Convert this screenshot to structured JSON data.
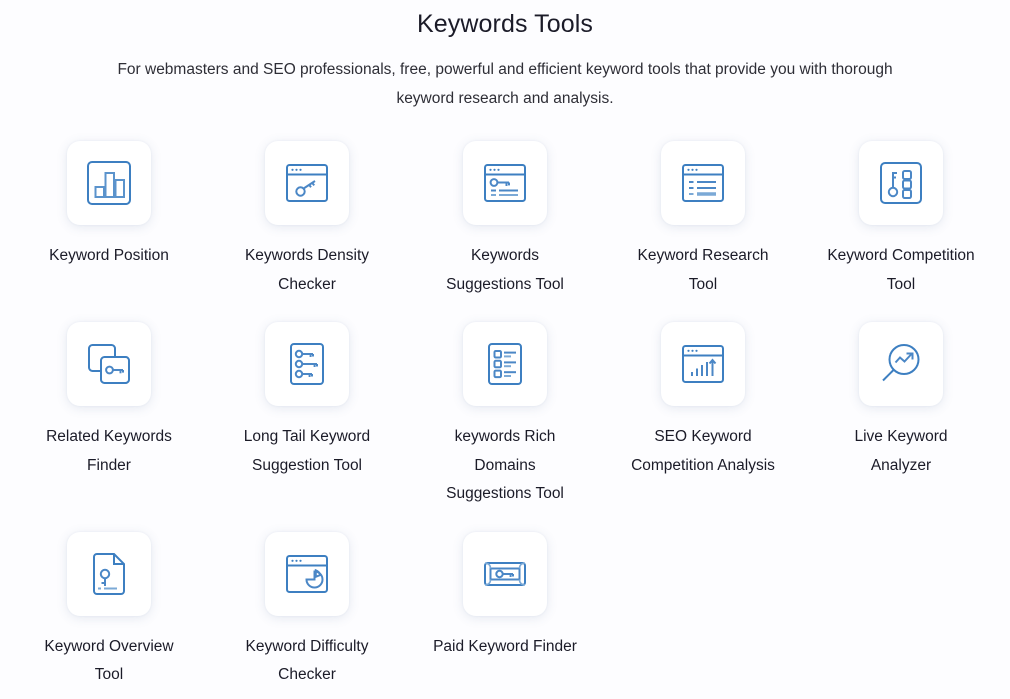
{
  "header": {
    "title": "Keywords Tools",
    "subtitle": "For webmasters and SEO professionals, free, powerful and efficient keyword tools that provide you with thorough keyword research and analysis."
  },
  "theme": {
    "page_background": "#fdfdff",
    "card_background": "#ffffff",
    "icon_stroke": "#3d7fc1",
    "icon_stroke_light": "#7ba9d6",
    "text_color": "#1b1b28",
    "subtitle_color": "#2e2e36"
  },
  "tools": [
    {
      "label": "Keyword Position",
      "icon": "bar-chart-icon"
    },
    {
      "label": "Keywords Density Checker",
      "icon": "browser-key-icon"
    },
    {
      "label": "Keywords Suggestions Tool",
      "icon": "browser-key-list-icon"
    },
    {
      "label": "Keyword Research Tool",
      "icon": "browser-list-icon"
    },
    {
      "label": "Keyword Competition Tool",
      "icon": "key-blocks-icon"
    },
    {
      "label": "Related Keywords Finder",
      "icon": "stacked-cards-key-icon"
    },
    {
      "label": "Long Tail Keyword Suggestion Tool",
      "icon": "document-keys-icon"
    },
    {
      "label": "keywords Rich Domains Suggestions Tool",
      "icon": "document-checklist-icon"
    },
    {
      "label": "SEO Keyword Competition Analysis",
      "icon": "browser-growth-chart-icon"
    },
    {
      "label": "Live Keyword Analyzer",
      "icon": "magnifier-trend-icon"
    },
    {
      "label": "Keyword Overview Tool",
      "icon": "document-key-icon"
    },
    {
      "label": "Keyword Difficulty Checker",
      "icon": "browser-pie-chart-icon"
    },
    {
      "label": "Paid Keyword Finder",
      "icon": "banknote-key-icon"
    }
  ]
}
